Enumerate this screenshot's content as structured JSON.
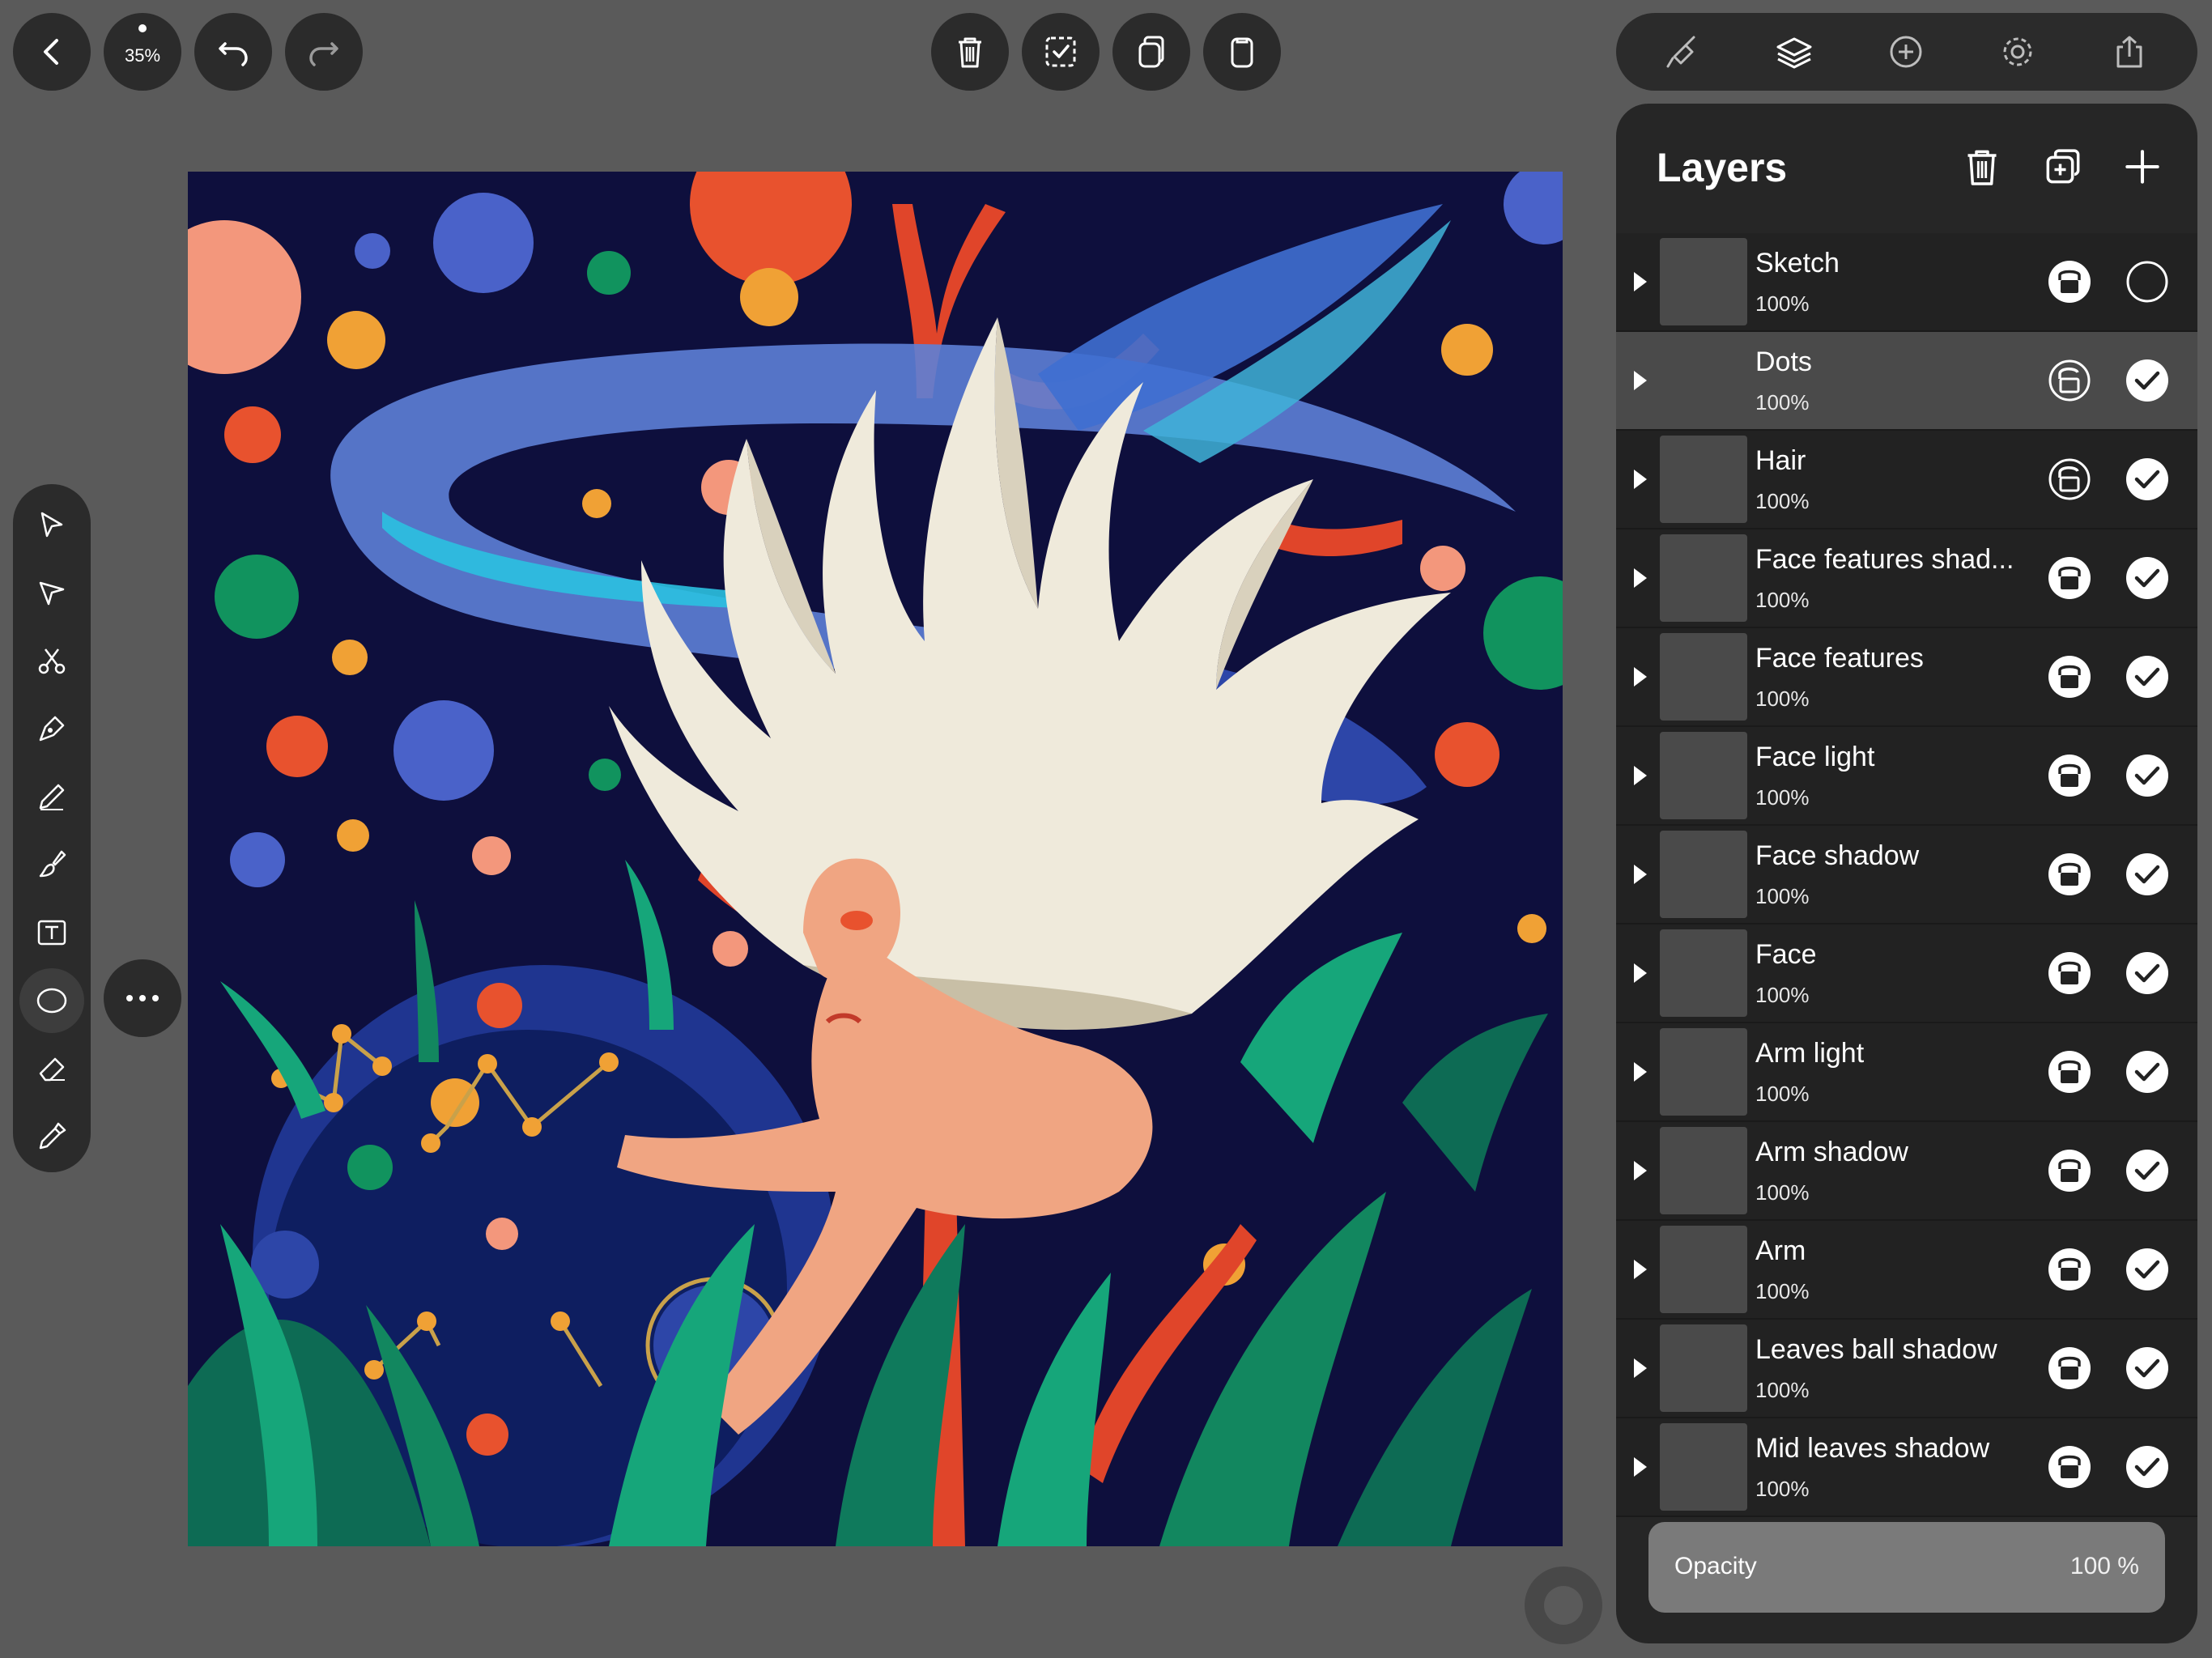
{
  "top_left": {
    "zoom_label": "35%"
  },
  "icons": {
    "back": "chevron-left-icon",
    "undo": "undo-icon",
    "redo": "redo-icon",
    "delete": "trash-icon",
    "select": "selection-icon",
    "duplicate": "duplicate-icon",
    "paste": "clipboard-icon",
    "style": "brush-style-icon",
    "layers": "layers-icon",
    "add": "plus-circle-icon",
    "settings": "gear-icon",
    "share": "share-icon"
  },
  "tools": [
    {
      "name": "select-tool",
      "icon": "arrow-select-icon"
    },
    {
      "name": "node-tool",
      "icon": "node-select-icon"
    },
    {
      "name": "scissors-tool",
      "icon": "scissors-icon"
    },
    {
      "name": "pen-tool",
      "icon": "pen-nib-icon"
    },
    {
      "name": "pencil-tool",
      "icon": "pencil-icon"
    },
    {
      "name": "brush-tool",
      "icon": "brush-icon"
    },
    {
      "name": "text-tool",
      "icon": "text-icon"
    },
    {
      "name": "shape-tool",
      "icon": "ellipse-icon",
      "active": true
    },
    {
      "name": "eraser-tool",
      "icon": "eraser-icon"
    },
    {
      "name": "eyedropper-tool",
      "icon": "eyedropper-icon"
    }
  ],
  "layers_panel": {
    "title": "Layers",
    "layers": [
      {
        "name": "Sketch",
        "opacity": "100%",
        "locked": true,
        "visible": false,
        "selected": false
      },
      {
        "name": "Dots",
        "opacity": "100%",
        "locked": false,
        "visible": true,
        "selected": true
      },
      {
        "name": "Hair",
        "opacity": "100%",
        "locked": false,
        "visible": true,
        "selected": false
      },
      {
        "name": "Face features shad...",
        "opacity": "100%",
        "locked": true,
        "visible": true,
        "selected": false
      },
      {
        "name": "Face features",
        "opacity": "100%",
        "locked": true,
        "visible": true,
        "selected": false
      },
      {
        "name": "Face light",
        "opacity": "100%",
        "locked": true,
        "visible": true,
        "selected": false
      },
      {
        "name": "Face shadow",
        "opacity": "100%",
        "locked": true,
        "visible": true,
        "selected": false
      },
      {
        "name": "Face",
        "opacity": "100%",
        "locked": true,
        "visible": true,
        "selected": false
      },
      {
        "name": "Arm light",
        "opacity": "100%",
        "locked": true,
        "visible": true,
        "selected": false
      },
      {
        "name": "Arm shadow",
        "opacity": "100%",
        "locked": true,
        "visible": true,
        "selected": false
      },
      {
        "name": "Arm",
        "opacity": "100%",
        "locked": true,
        "visible": true,
        "selected": false
      },
      {
        "name": "Leaves ball shadow",
        "opacity": "100%",
        "locked": true,
        "visible": true,
        "selected": false
      },
      {
        "name": "Mid leaves shadow",
        "opacity": "100%",
        "locked": true,
        "visible": true,
        "selected": false
      }
    ],
    "opacity": {
      "label": "Opacity",
      "value": "100 %"
    }
  },
  "colors": {
    "canvas_bg": "#0e0f3d",
    "ui_dark": "#2b2b2b",
    "workspace": "#5a5a5a",
    "selected_row": "#4a4a4a"
  }
}
